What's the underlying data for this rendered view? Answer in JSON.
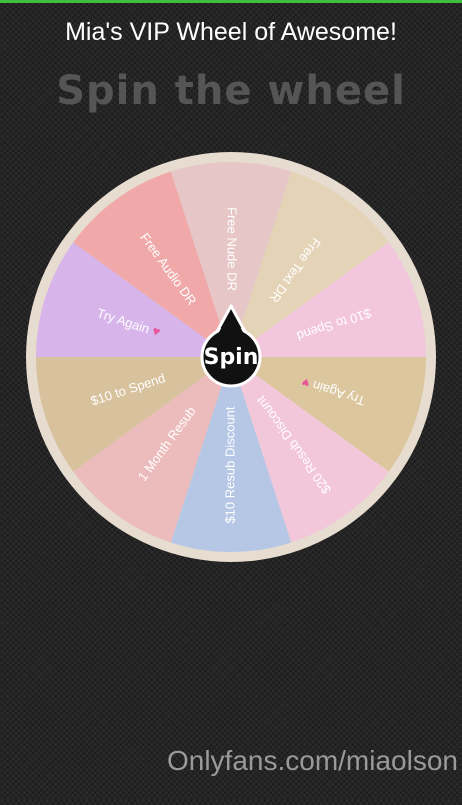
{
  "header": {
    "title": "Mia's VIP Wheel of Awesome!",
    "subtitle": "Spin the wheel"
  },
  "wheel": {
    "spin_label": "Spin",
    "segments": [
      {
        "label": "Free Nude DR",
        "color": "#e6c6c6"
      },
      {
        "label": "Free Text DR",
        "color": "#e4d3b6"
      },
      {
        "label": "$10 to Spend",
        "color": "#f2c6dc"
      },
      {
        "label": "Try Again",
        "color": "#dcc69e",
        "heart": true
      },
      {
        "label": "$20 Resub Discount",
        "color": "#f3c7da"
      },
      {
        "label": "$10 Resub Discount",
        "color": "#b6c7e6"
      },
      {
        "label": "1 Month Resub",
        "color": "#ecbcbc"
      },
      {
        "label": "$10 to Spend",
        "color": "#d8c29d"
      },
      {
        "label": "Try Again",
        "color": "#d7b4ea",
        "heart": true
      },
      {
        "label": "Free Audio DR",
        "color": "#f0a8a8"
      }
    ],
    "rim_color": "#e6dccf",
    "hub_color": "#111111",
    "heart_color": "#e8559a"
  },
  "footer": {
    "watermark": "Onlyfans.com/miaolson"
  }
}
